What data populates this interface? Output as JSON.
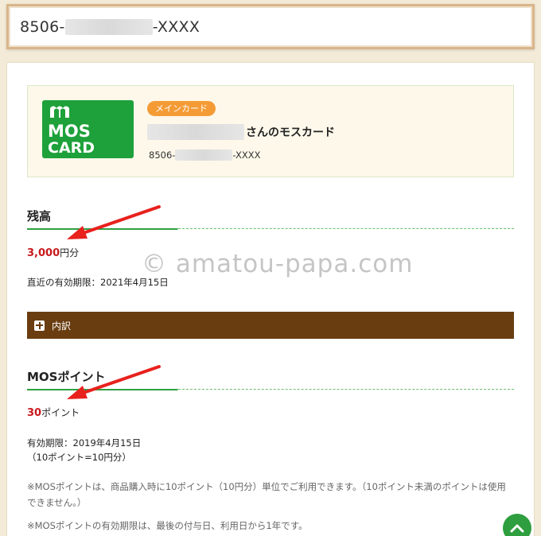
{
  "header": {
    "card_prefix": "8506-",
    "card_suffix": "-XXXX"
  },
  "card": {
    "logo_line1": "MOS",
    "logo_line2": "CARD",
    "badge": "メインカード",
    "holder_suffix": "さんのモスカード",
    "number_prefix": "8506-",
    "number_suffix": "-XXXX"
  },
  "balance": {
    "title": "残高",
    "value": "3,000",
    "unit": "円分",
    "expiry": "直近の有効期限：2021年4月15日"
  },
  "breakdown": {
    "label": "内訳"
  },
  "points": {
    "title": "MOSポイント",
    "value": "30",
    "unit": "ポイント",
    "expiry": "有効期限：2019年4月15日",
    "rate": "（10ポイント=10円分）",
    "note1": "※MOSポイントは、商品購入時に10ポイント（10円分）単位でご利用できます。（10ポイント未満のポイントは使用できません。）",
    "note2": "※MOSポイントの有効期限は、最後の付与日、利用日から1年です。"
  },
  "watermark": "© amatou-papa.com",
  "colors": {
    "accent_green": "#2ea043",
    "badge_orange": "#f49b36",
    "breakdown_brown": "#6a3d10",
    "value_red": "#c8191e"
  }
}
